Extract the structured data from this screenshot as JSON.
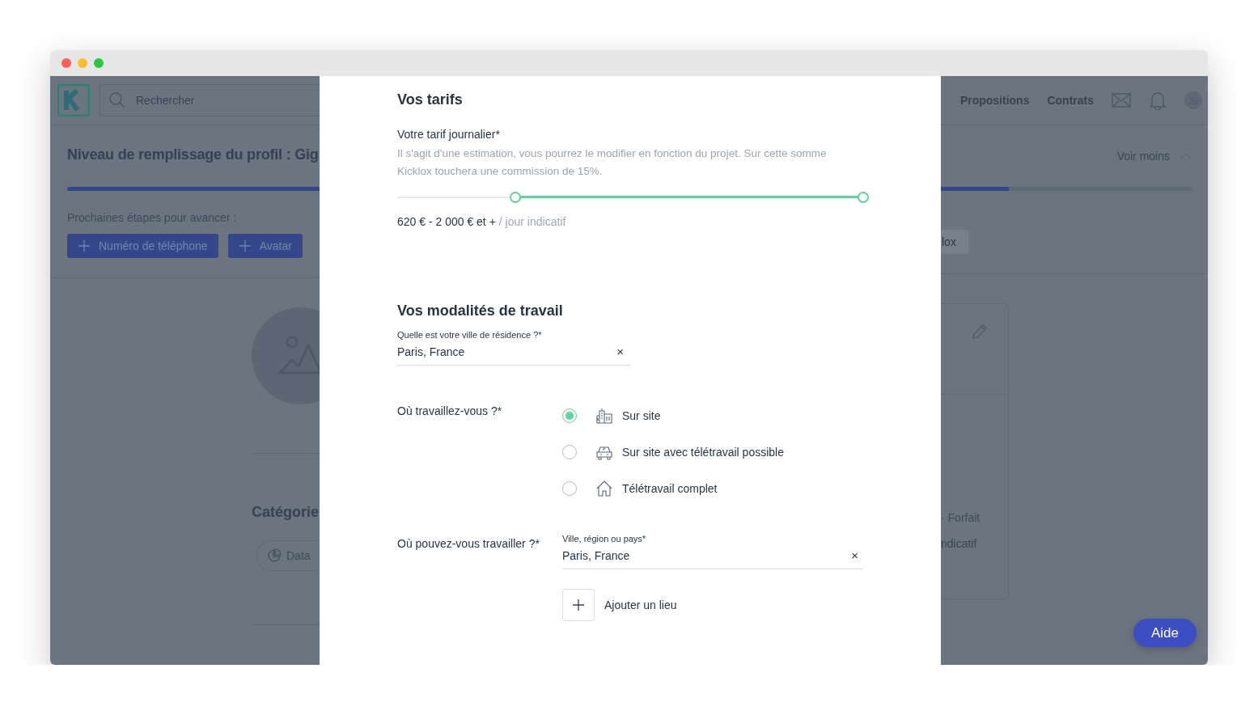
{
  "window": {
    "controls": [
      {
        "color": "#fe5f57"
      },
      {
        "color": "#febc2e"
      },
      {
        "color": "#28c840"
      }
    ]
  },
  "app": {
    "search": {
      "placeholder": "Rechercher"
    },
    "nav": [
      "Propositions",
      "Contrats"
    ],
    "profile": {
      "title": "Niveau de remplissage du profil : Gig",
      "toggle": "Voir moins",
      "progress": {
        "level": 0.837
      },
      "next_steps_label": "Prochaines étapes pour avancer :",
      "steps": [
        "Numéro de téléphone",
        "Avatar",
        "lox"
      ]
    },
    "category_title": "Catégorie",
    "category_chips": [
      {
        "label": "Data"
      }
    ],
    "card": {
      "line_1": "· Forfait",
      "line_2": "ndicatif"
    },
    "help_button": "Aide"
  },
  "modal": {
    "rates": {
      "title": "Vos tarifs",
      "label": "Votre tarif journalier*",
      "help": "Il s'agit d'une estimation, vous pourrez le modifier en fonction du projet. Sur cette somme Kicklox touchera une commission de 15%.",
      "slider": {
        "thumbs": [
          {
            "level": 0.253
          },
          {
            "level": 1
          }
        ]
      },
      "range": "620 € - 2 000 € et +",
      "range_suffix": "/ jour indicatif"
    },
    "work": {
      "title": "Vos modalités de travail",
      "residence": {
        "label": "Quelle est votre ville de résidence ?*",
        "value": "Paris, France",
        "clear": "×"
      },
      "where_label": "Où travaillez-vous ?*",
      "options": [
        {
          "label": "Sur site",
          "kind": "building",
          "selected": true
        },
        {
          "label": "Sur site avec télétravail possible",
          "kind": "car",
          "selected": false
        },
        {
          "label": "Télétravail complet",
          "kind": "house",
          "selected": false
        }
      ],
      "places_label": "Où pouvez-vous travailler ?*",
      "place": {
        "label": "Ville, région ou pays*",
        "value": "Paris, France",
        "clear": "×"
      },
      "add_place": "Ajouter un lieu"
    }
  }
}
